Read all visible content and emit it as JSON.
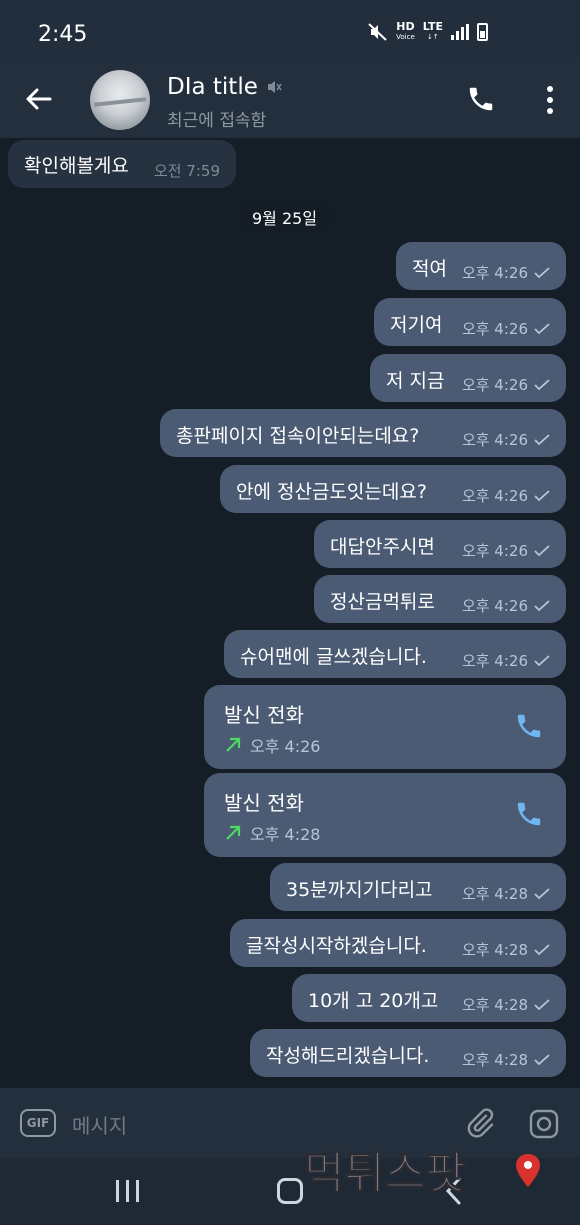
{
  "status_bar": {
    "time": "2:45",
    "hd_label": "HD",
    "hd_sub": "Voice",
    "lte_label": "LTE"
  },
  "header": {
    "title": "DIa title",
    "subtitle": "최근에 접속함"
  },
  "chat": {
    "first_incoming": {
      "text": "확인해볼게요",
      "time": "오전 7:59"
    },
    "date_chip": "9월 25일",
    "outgoing": [
      {
        "text": "적여",
        "time": "오후 4:26"
      },
      {
        "text": "저기여",
        "time": "오후 4:26"
      },
      {
        "text": "저 지금",
        "time": "오후 4:26"
      },
      {
        "text": "총판페이지 접속이안되는데요?",
        "time": "오후 4:26"
      },
      {
        "text": "안에 정산금도잇는데요?",
        "time": "오후 4:26"
      },
      {
        "text": "대답안주시면",
        "time": "오후 4:26"
      },
      {
        "text": "정산금먹튀로",
        "time": "오후 4:26"
      },
      {
        "text": "슈어맨에 글쓰겠습니다.",
        "time": "오후 4:26"
      }
    ],
    "calls": [
      {
        "label": "발신 전화",
        "time": "오후 4:26"
      },
      {
        "label": "발신 전화",
        "time": "오후 4:28"
      }
    ],
    "outgoing_after": [
      {
        "text": "35분까지기다리고",
        "time": "오후 4:28"
      },
      {
        "text": "글작성시작하겠습니다.",
        "time": "오후 4:28"
      },
      {
        "text": "10개 고 20개고",
        "time": "오후 4:28"
      },
      {
        "text": "작성해드리겠습니다.",
        "time": "오후 4:28"
      }
    ]
  },
  "composer": {
    "gif_label": "GIF",
    "placeholder": "메시지"
  },
  "watermark": {
    "text": "먹튀스팟"
  },
  "colors": {
    "outgoing_bubble": "#4b5b74",
    "chat_bg": "#151e27",
    "header_bg": "#232f3d",
    "call_arrow": "#4cd964",
    "accent": "#6fb6f2"
  },
  "icons": [
    "back-arrow-icon",
    "mute-icon",
    "phone-icon",
    "more-vertical-icon",
    "check-icon",
    "outgoing-arrow-icon",
    "gif-icon",
    "attach-icon",
    "camera-icon"
  ]
}
